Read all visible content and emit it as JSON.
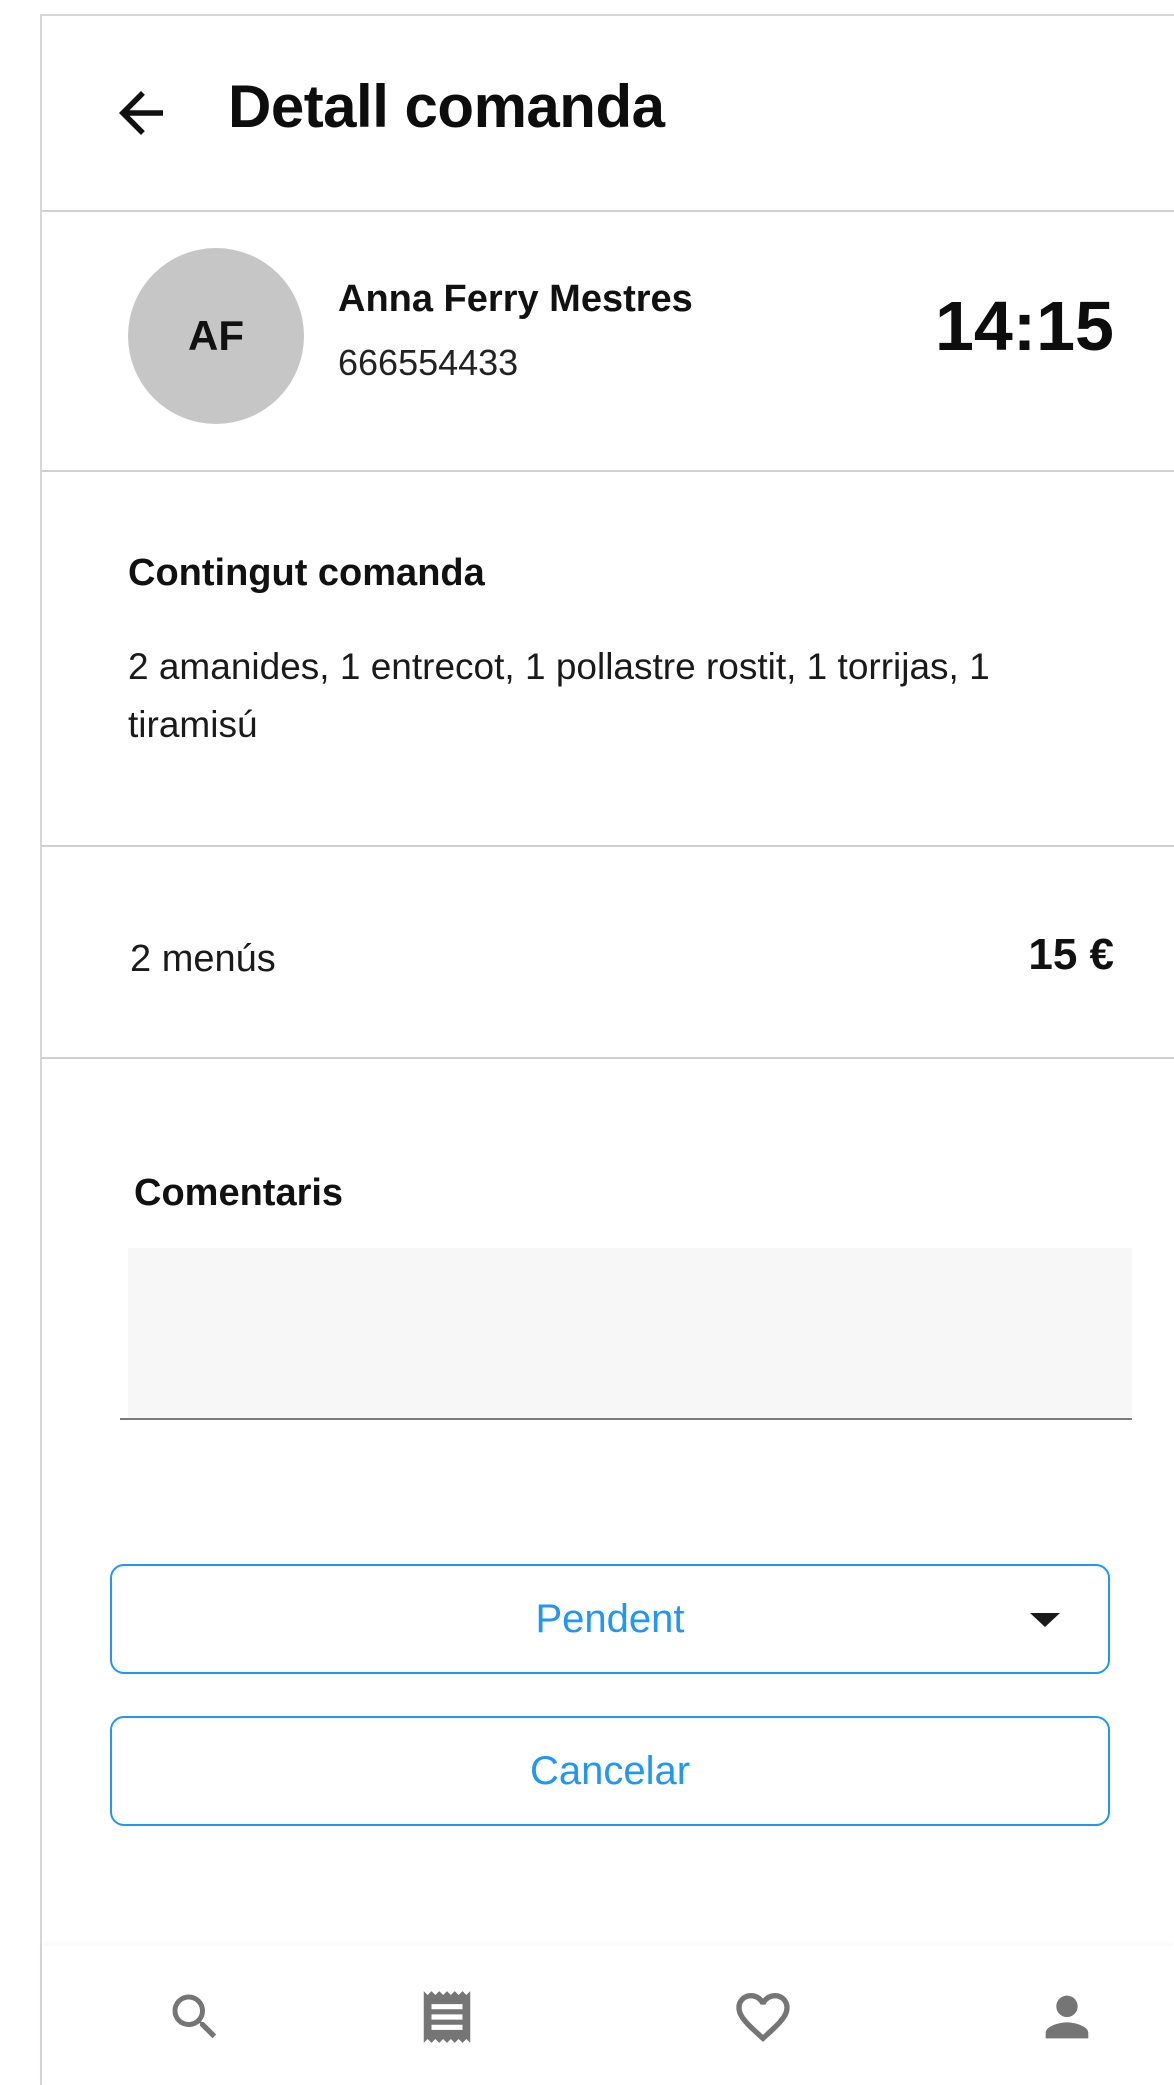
{
  "header": {
    "title": "Detall comanda",
    "back_icon": "arrow-left-icon"
  },
  "customer": {
    "initials": "AF",
    "name": "Anna Ferry Mestres",
    "phone": "666554433",
    "time": "14:15"
  },
  "order": {
    "contents_heading": "Contingut comanda",
    "contents": "2 amanides, 1 entrecot, 1 pollastre rostit, 1 torrijas, 1 tiramisú",
    "menus": "2 menús",
    "price": "15 €"
  },
  "comments": {
    "heading": "Comentaris",
    "value": ""
  },
  "actions": {
    "status_selected": "Pendent",
    "cancel_label": "Cancelar",
    "accent_color": "#2196f3"
  },
  "bottom_nav": {
    "items": [
      {
        "icon": "search-icon"
      },
      {
        "icon": "receipt-icon"
      },
      {
        "icon": "heart-icon"
      },
      {
        "icon": "person-icon"
      }
    ],
    "icon_color": "#757575"
  }
}
